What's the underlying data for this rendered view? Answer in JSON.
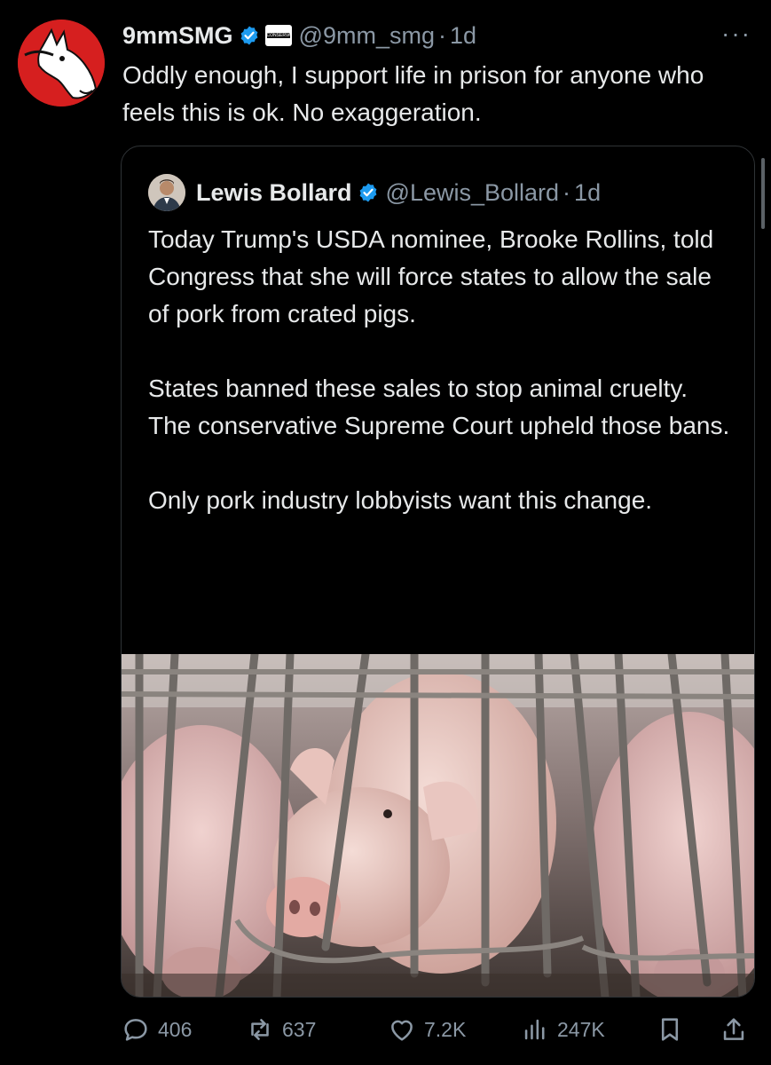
{
  "tweet": {
    "author_name": "9mmSMG",
    "affiliation_badge": "CONSERVATIVE",
    "handle": "@9mm_smg",
    "separator": "·",
    "time": "1d",
    "more": "···",
    "text": "Oddly enough, I support life in prison for anyone who feels this is ok. No exaggeration."
  },
  "quote": {
    "author_name": "Lewis Bollard",
    "handle": "@Lewis_Bollard",
    "separator": "·",
    "time": "1d",
    "paragraphs": [
      "Today Trump's USDA nominee, Brooke Rollins, told Congress that she will force states to allow the sale of pork from crated pigs.",
      "States banned these sales to stop animal cruelty. The conservative Supreme Court upheld those bans.",
      "Only pork industry lobbyists want this change."
    ]
  },
  "actions": {
    "replies": "406",
    "reposts": "637",
    "likes": "7.2K",
    "views": "247K"
  },
  "colors": {
    "background": "#000000",
    "text": "#e7e9ea",
    "secondary": "#8b98a5",
    "verified": "#1d9bf0",
    "avatar_red": "#d61f1f"
  },
  "icons": [
    "verified-icon",
    "more-icon",
    "reply-icon",
    "repost-icon",
    "like-icon",
    "views-icon",
    "bookmark-icon",
    "share-icon"
  ]
}
